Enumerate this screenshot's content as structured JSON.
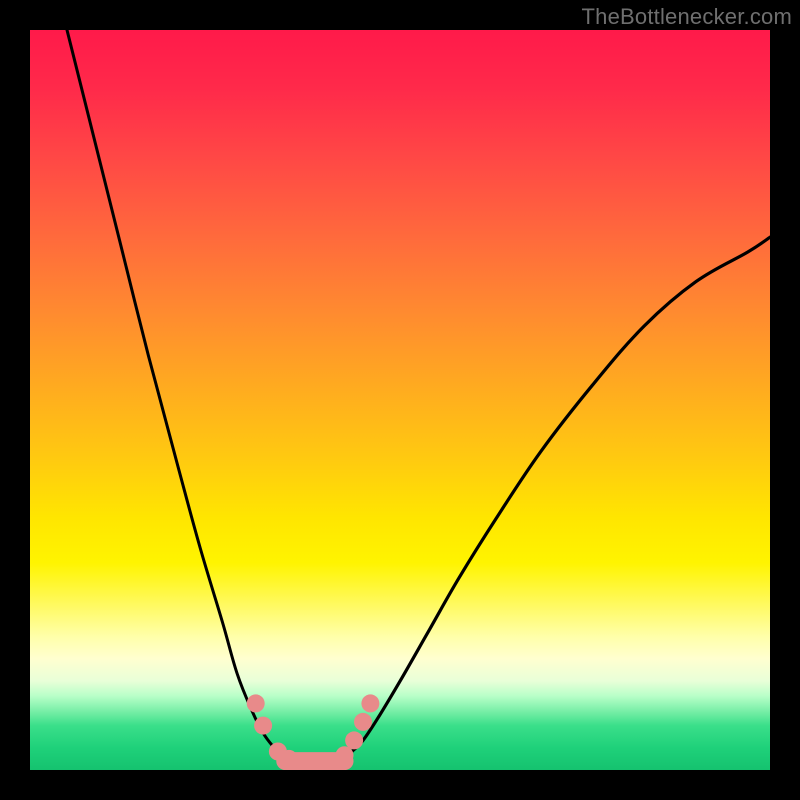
{
  "watermark": "TheBottlenecker.com",
  "chart_data": {
    "type": "line",
    "title": "",
    "xlabel": "",
    "ylabel": "",
    "xlim": [
      0,
      100
    ],
    "ylim": [
      0,
      100
    ],
    "grid": false,
    "series": [
      {
        "name": "left-branch",
        "x": [
          5,
          8,
          12,
          16,
          20,
          23,
          26,
          28,
          30,
          31.5,
          33,
          34,
          35
        ],
        "values": [
          100,
          88,
          72,
          56,
          41,
          30,
          20,
          13,
          8,
          5,
          3,
          2,
          1.2
        ]
      },
      {
        "name": "right-branch",
        "x": [
          42,
          43.5,
          45,
          47,
          50,
          54,
          58,
          63,
          69,
          76,
          83,
          90,
          97,
          100
        ],
        "values": [
          1.2,
          2.5,
          4,
          7,
          12,
          19,
          26,
          34,
          43,
          52,
          60,
          66,
          70,
          72
        ]
      },
      {
        "name": "valley-floor",
        "x": [
          33,
          34.5,
          36,
          38,
          40,
          41,
          42,
          43
        ],
        "values": [
          3,
          1.8,
          1.2,
          1.0,
          1.0,
          1.2,
          1.8,
          3
        ]
      }
    ],
    "markers": {
      "left": [
        {
          "x": 30.5,
          "y": 9.0
        },
        {
          "x": 31.5,
          "y": 6.0
        },
        {
          "x": 33.5,
          "y": 2.5
        },
        {
          "x": 35.0,
          "y": 1.5
        }
      ],
      "right": [
        {
          "x": 42.5,
          "y": 2.0
        },
        {
          "x": 43.8,
          "y": 4.0
        },
        {
          "x": 45.0,
          "y": 6.5
        },
        {
          "x": 46.0,
          "y": 9.0
        }
      ],
      "bottom_bar": {
        "x0": 34.5,
        "x1": 42.5,
        "y": 1.2
      }
    },
    "colors": {
      "curve": "#000000",
      "marker_fill": "#e88a8a",
      "marker_stroke": "#d07070"
    }
  }
}
